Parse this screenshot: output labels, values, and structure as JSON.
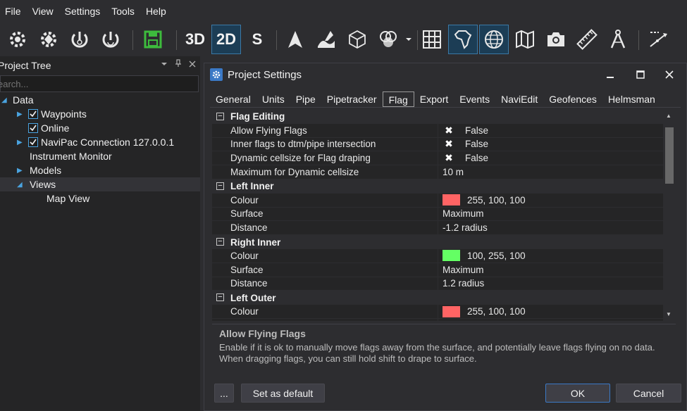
{
  "menu": [
    "File",
    "View",
    "Settings",
    "Tools",
    "Help"
  ],
  "toolbar": {
    "label_3d": "3D",
    "label_2d": "2D",
    "label_s": "S"
  },
  "project_tree": {
    "title": "Project Tree",
    "search_placeholder": "earch...",
    "items": [
      {
        "label": "Data"
      },
      {
        "label": "Waypoints"
      },
      {
        "label": "Online"
      },
      {
        "label": "NaviPac Connection 127.0.0.1"
      },
      {
        "label": "Instrument Monitor"
      },
      {
        "label": "Models"
      },
      {
        "label": "Views"
      },
      {
        "label": "Map View"
      }
    ]
  },
  "dialog": {
    "title": "Project Settings",
    "tabs": [
      "General",
      "Units",
      "Pipe",
      "Pipetracker",
      "Flag",
      "Export",
      "Events",
      "NaviEdit",
      "Geofences",
      "Helmsman"
    ],
    "active_tab": "Flag",
    "grid": {
      "flag_editing": {
        "title": "Flag Editing",
        "allow_flying": {
          "name": "Allow Flying Flags",
          "value": "False"
        },
        "inner_flags": {
          "name": "Inner flags to dtm/pipe intersection",
          "value": "False"
        },
        "dynamic_cellsize": {
          "name": "Dynamic cellsize for Flag draping",
          "value": "False"
        },
        "max_dynamic": {
          "name": "Maximum for Dynamic cellsize",
          "value": "10 m"
        }
      },
      "left_inner": {
        "title": "Left Inner",
        "colour": {
          "name": "Colour",
          "value": "255, 100, 100",
          "swatch": "#ff6464"
        },
        "surface": {
          "name": "Surface",
          "value": "Maximum"
        },
        "distance": {
          "name": "Distance",
          "value": "-1.2 radius"
        }
      },
      "right_inner": {
        "title": "Right Inner",
        "colour": {
          "name": "Colour",
          "value": "100, 255, 100",
          "swatch": "#64ff64"
        },
        "surface": {
          "name": "Surface",
          "value": "Maximum"
        },
        "distance": {
          "name": "Distance",
          "value": "1.2 radius"
        }
      },
      "left_outer": {
        "title": "Left Outer",
        "colour": {
          "name": "Colour",
          "value": "255, 100, 100",
          "swatch": "#ff6464"
        }
      }
    },
    "description": {
      "title": "Allow Flying Flags",
      "text": "Enable if it is ok to manually move flags away from the surface, and potentially leave flags flying on no data. When dragging flags, you can still hold shift to drape to surface."
    },
    "buttons": {
      "ellipsis": "...",
      "set_default": "Set as default",
      "ok": "OK",
      "cancel": "Cancel"
    }
  },
  "colors": {
    "accent": "#3b79c6",
    "save_green": "#3dbb3d"
  }
}
